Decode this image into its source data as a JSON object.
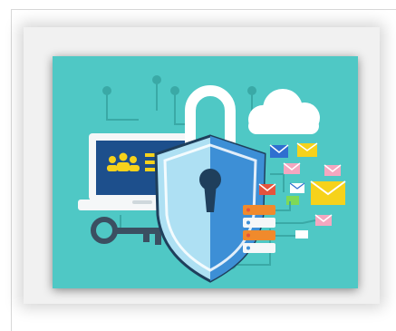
{
  "image": {
    "colors": {
      "background": "#4fc8c5",
      "circuit": "#3aa9a6",
      "shield_light": "#aee0f3",
      "shield_dark": "#3d8fd6",
      "shield_outline": "#1f3f5c",
      "laptop_frame": "#f5f7f8",
      "laptop_screen": "#1d4f8c",
      "accent_yellow": "#f6d21b",
      "envelope_red": "#e5533d",
      "envelope_pink": "#f4a7c0",
      "server_orange": "#f08a2c",
      "key": "#3b4f61",
      "cloud": "#ffffff",
      "mail_blue": "#2f6fd0",
      "mail_green": "#7ed957"
    }
  }
}
